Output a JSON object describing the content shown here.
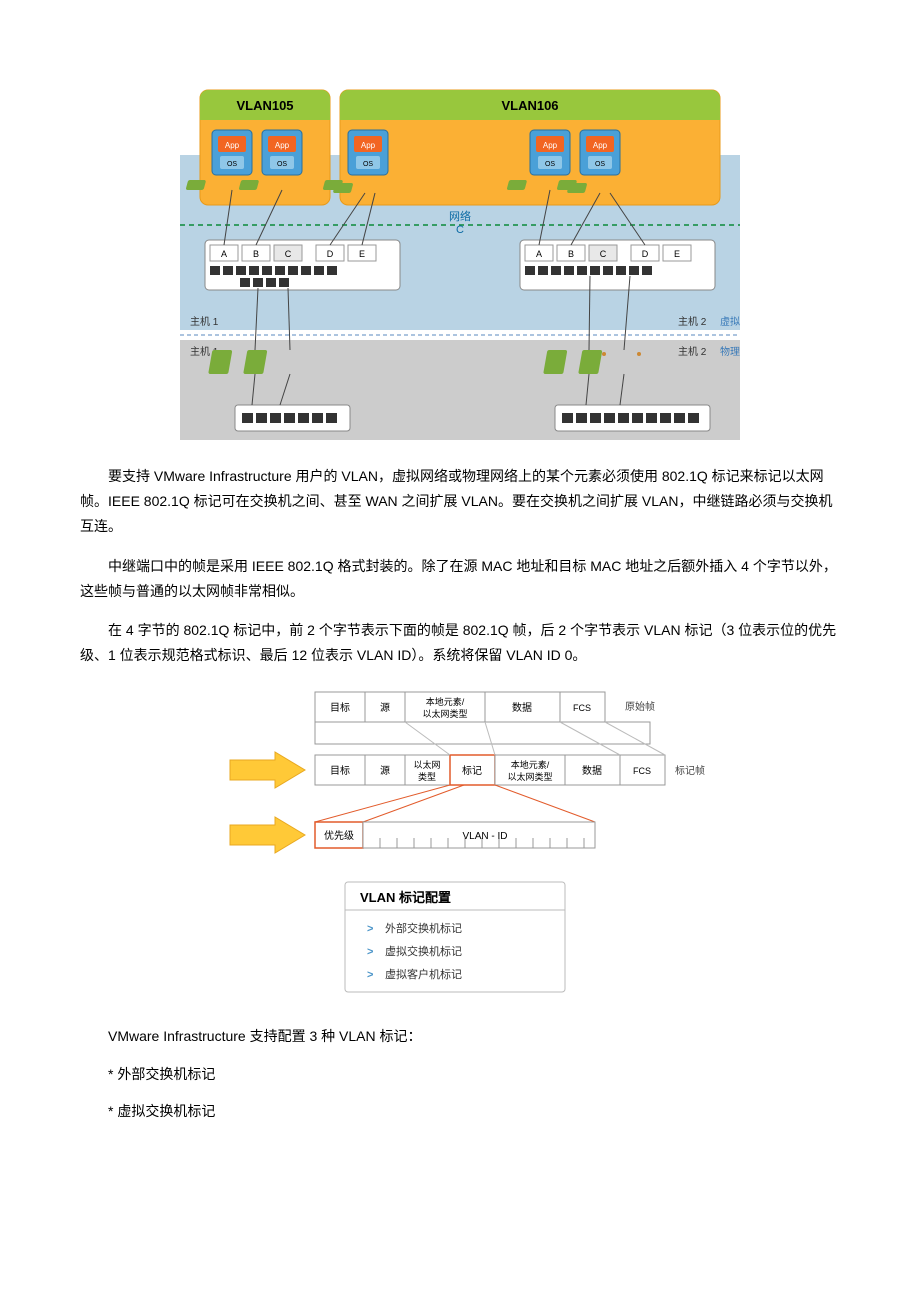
{
  "diagram1": {
    "vlan105": "VLAN105",
    "vlan106": "VLAN106",
    "app": "App",
    "os": "OS",
    "networkC": "网络",
    "networkC2": "C",
    "host1": "主机 1",
    "host2": "主机 2",
    "virtual": "虚拟",
    "physical": "物理",
    "portA": "A",
    "portB": "B",
    "portC": "C",
    "portD": "D",
    "portE": "E"
  },
  "para1": "要支持 VMware Infrastructure 用户的 VLAN，虚拟网络或物理网络上的某个元素必须使用 802.1Q 标记来标记以太网帧。IEEE 802.1Q 标记可在交换机之间、甚至 WAN 之间扩展 VLAN。要在交换机之间扩展 VLAN，中继链路必须与交换机互连。",
  "para2": "中继端口中的帧是采用 IEEE 802.1Q 格式封装的。除了在源 MAC 地址和目标 MAC 地址之后额外插入 4 个字节以外，这些帧与普通的以太网帧非常相似。",
  "para3": "在 4 字节的 802.1Q 标记中，前 2 个字节表示下面的帧是 802.1Q 帧，后 2 个字节表示 VLAN 标记（3 位表示位的优先级、1 位表示规范格式标识、最后 12 位表示 VLAN ID）。系统将保留 VLAN ID 0。",
  "diagram2": {
    "dest": "目标",
    "src": "源",
    "local_eth": "本地元素/",
    "local_eth2": "以太网类型",
    "eth_type": "以太网",
    "eth_type2": "类型",
    "tag": "标记",
    "data": "数据",
    "fcs": "FCS",
    "orig_frame": "原始帧",
    "tag_frame": "标记帧",
    "priority": "优先级",
    "vlan_id": "VLAN - ID",
    "config_title": "VLAN 标记配置",
    "config1": "外部交换机标记",
    "config2": "虚拟交换机标记",
    "config3": "虚拟客户机标记"
  },
  "para4": "VMware Infrastructure 支持配置 3 种 VLAN 标记：",
  "bullet1": "* 外部交换机标记",
  "bullet2": "* 虚拟交换机标记"
}
